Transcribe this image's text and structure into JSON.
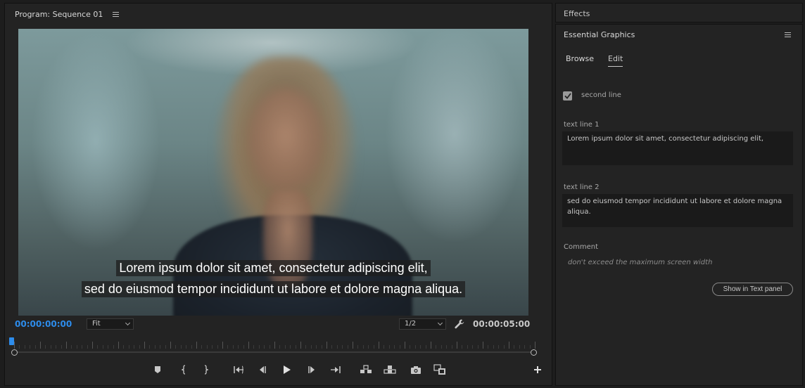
{
  "program_monitor": {
    "tab_title": "Program: Sequence 01",
    "subtitle_line_1": "Lorem ipsum dolor sit amet, consectetur adipiscing elit,",
    "subtitle_line_2": "sed do eiusmod tempor incididunt ut labore et dolore magna aliqua.",
    "current_timecode": "00:00:00:00",
    "duration_timecode": "00:00:05:00",
    "zoom_level": "Fit",
    "playback_resolution": "1/2",
    "timecode_color": "#2d8ceb",
    "icons": [
      "panel-menu-icon",
      "wrench-icon",
      "add-marker-icon",
      "mark-in-icon",
      "mark-out-icon",
      "go-to-in-icon",
      "step-back-icon",
      "play-icon",
      "step-forward-icon",
      "go-to-out-icon",
      "insert-icon",
      "overwrite-icon",
      "export-frame-icon",
      "comparison-view-icon",
      "button-editor-icon"
    ]
  },
  "effects_panel": {
    "title": "Effects"
  },
  "essential_graphics": {
    "title": "Essential Graphics",
    "tabs": [
      {
        "label": "Browse"
      },
      {
        "label": "Edit"
      }
    ],
    "active_tab": "Edit",
    "second_line_checkbox": {
      "label": "second line",
      "checked": true
    },
    "text_line_1": {
      "label": "text line 1",
      "value": "Lorem ipsum dolor sit amet, consectetur adipiscing elit,"
    },
    "text_line_2": {
      "label": "text line 2",
      "value": "sed do eiusmod tempor incididunt ut labore et dolore magna aliqua."
    },
    "comment": {
      "label": "Comment",
      "text": "don't exceed the maximum screen width"
    },
    "show_in_text_panel_label": "Show in Text panel"
  }
}
